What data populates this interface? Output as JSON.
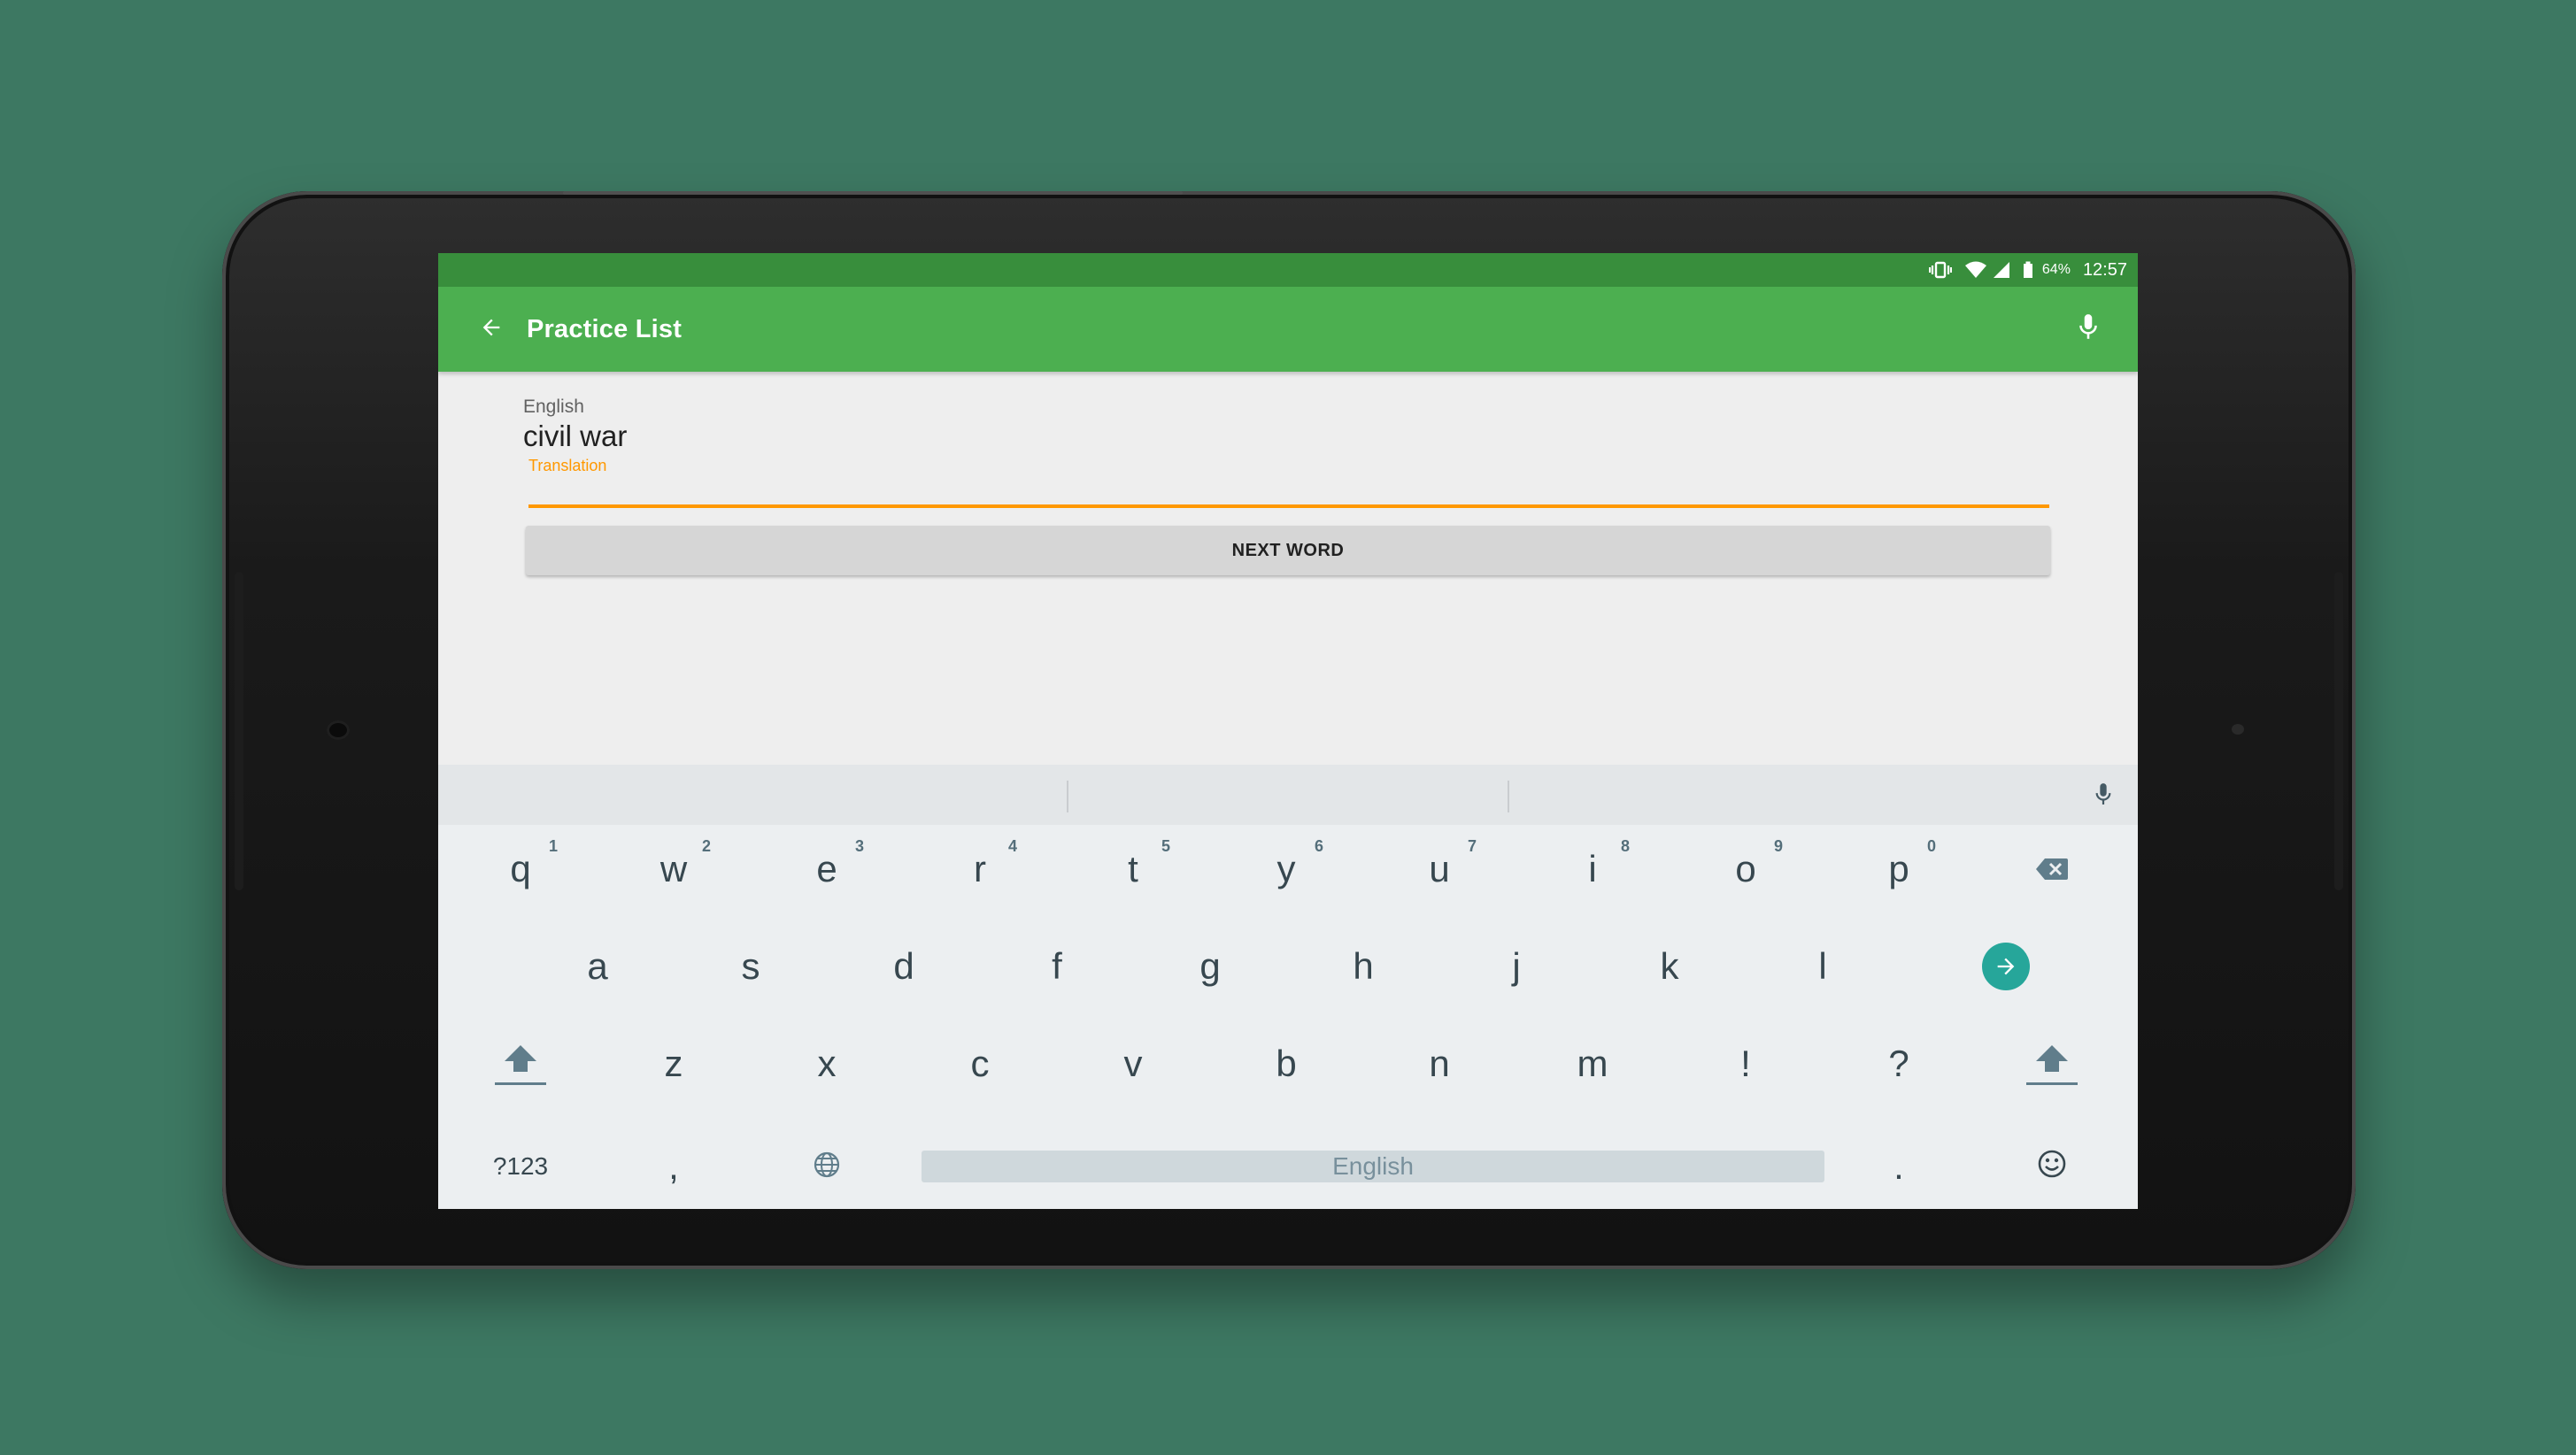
{
  "status_bar": {
    "battery": "64%",
    "time": "12:57"
  },
  "app_bar": {
    "title": "Practice List"
  },
  "card": {
    "language_label": "English",
    "word": "civil war",
    "input_label": "Translation",
    "next_button": "NEXT WORD"
  },
  "keyboard": {
    "row1": [
      {
        "key": "q",
        "hint": "1"
      },
      {
        "key": "w",
        "hint": "2"
      },
      {
        "key": "e",
        "hint": "3"
      },
      {
        "key": "r",
        "hint": "4"
      },
      {
        "key": "t",
        "hint": "5"
      },
      {
        "key": "y",
        "hint": "6"
      },
      {
        "key": "u",
        "hint": "7"
      },
      {
        "key": "i",
        "hint": "8"
      },
      {
        "key": "o",
        "hint": "9"
      },
      {
        "key": "p",
        "hint": "0"
      }
    ],
    "row2": [
      "a",
      "s",
      "d",
      "f",
      "g",
      "h",
      "j",
      "k",
      "l"
    ],
    "row3": [
      "z",
      "x",
      "c",
      "v",
      "b",
      "n",
      "m",
      "!",
      "?"
    ],
    "bottom": {
      "symbols": "?123",
      "comma": ",",
      "space": "English",
      "period": "."
    }
  },
  "icons": {
    "back": "arrow-left-icon",
    "mic": "microphone-icon",
    "backspace": "backspace-icon",
    "enter": "arrow-right-circle-icon",
    "shift": "shift-icon",
    "globe": "globe-icon",
    "emoji": "emoji-icon"
  },
  "colors": {
    "background": "#3d7862",
    "status_bar": "#388e3c",
    "app_bar": "#4caf50",
    "accent": "#ff9800",
    "enter_key": "#26a69a"
  }
}
